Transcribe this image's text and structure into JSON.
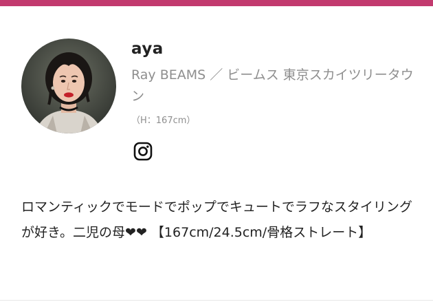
{
  "colors": {
    "accent_bar": "#c23a6e",
    "secondary_text": "#8e8e8e",
    "primary_text": "#222222"
  },
  "profile": {
    "name": "aya",
    "shop": "Ray BEAMS ／ ビームス 東京スカイツリータウン",
    "height": "（H：167cm）",
    "social_icon": "instagram-icon",
    "bio": "ロマンティックでモードでポップでキュートでラフなスタイリングが好き。二児の母❤❤ 【167cm/24.5cm/骨格ストレート】"
  }
}
